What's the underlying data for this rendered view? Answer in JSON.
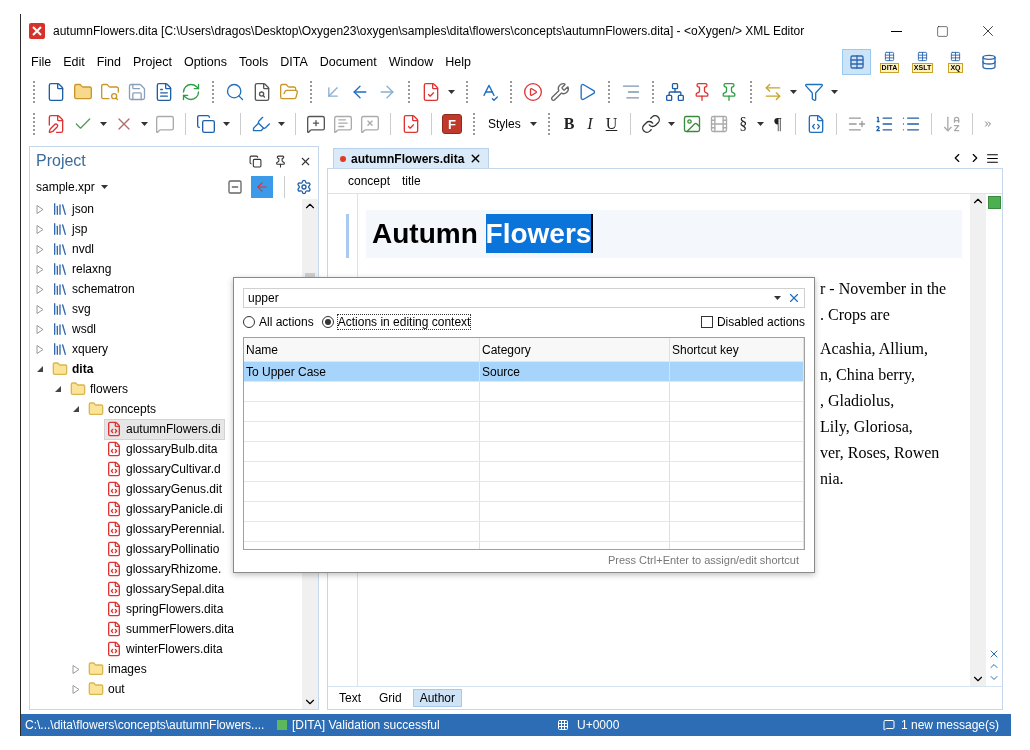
{
  "window": {
    "title": "autumnFlowers.dita [C:\\Users\\dragos\\Desktop\\Oxygen23\\oxygen\\samples\\dita\\flowers\\concepts\\autumnFlowers.dita] - <oXygen/> XML Editor"
  },
  "menu": [
    "File",
    "Edit",
    "Find",
    "Project",
    "Options",
    "Tools",
    "DITA",
    "Document",
    "Window",
    "Help"
  ],
  "perspectives": [
    {
      "kind": "editor",
      "selected": true
    },
    {
      "kind": "tagged",
      "label": "DITA",
      "selected": false
    },
    {
      "kind": "tagged",
      "label": "XSLT",
      "selected": false
    },
    {
      "kind": "tagged",
      "label": "XQ",
      "selected": false
    },
    {
      "kind": "database",
      "selected": false
    }
  ],
  "format_toolbar": {
    "framemaker": "F",
    "styles": "Styles",
    "bold": "B",
    "italic": "I",
    "underline": "U",
    "section": "§",
    "pilcrow": "¶"
  },
  "project": {
    "title": "Project",
    "file": "sample.xpr",
    "link_active": true,
    "tree": [
      {
        "label": "json",
        "kind": "module",
        "expanded": false,
        "bold": false,
        "selected": false
      },
      {
        "label": "jsp",
        "kind": "module",
        "expanded": false,
        "bold": false,
        "selected": false
      },
      {
        "label": "nvdl",
        "kind": "module",
        "expanded": false,
        "bold": false,
        "selected": false
      },
      {
        "label": "relaxng",
        "kind": "module",
        "expanded": false,
        "bold": false,
        "selected": false
      },
      {
        "label": "schematron",
        "kind": "module",
        "expanded": false,
        "bold": false,
        "selected": false
      },
      {
        "label": "svg",
        "kind": "module",
        "expanded": false,
        "bold": false,
        "selected": false
      },
      {
        "label": "wsdl",
        "kind": "module",
        "expanded": false,
        "bold": false,
        "selected": false
      },
      {
        "label": "xquery",
        "kind": "module",
        "expanded": false,
        "bold": false,
        "selected": false
      },
      {
        "label": "dita",
        "kind": "folder",
        "expanded": true,
        "bold": true,
        "selected": false,
        "children": [
          {
            "label": "flowers",
            "kind": "folder",
            "expanded": true,
            "bold": false,
            "selected": false,
            "children": [
              {
                "label": "concepts",
                "kind": "folder",
                "expanded": true,
                "bold": false,
                "selected": false,
                "children": [
                  {
                    "label": "autumnFlowers.di",
                    "kind": "file",
                    "bold": false,
                    "selected": true
                  },
                  {
                    "label": "glossaryBulb.dita",
                    "kind": "file",
                    "bold": false,
                    "selected": false
                  },
                  {
                    "label": "glossaryCultivar.d",
                    "kind": "file",
                    "bold": false,
                    "selected": false
                  },
                  {
                    "label": "glossaryGenus.dit",
                    "kind": "file",
                    "bold": false,
                    "selected": false
                  },
                  {
                    "label": "glossaryPanicle.di",
                    "kind": "file",
                    "bold": false,
                    "selected": false
                  },
                  {
                    "label": "glossaryPerennial.",
                    "kind": "file",
                    "bold": false,
                    "selected": false
                  },
                  {
                    "label": "glossaryPollinatio",
                    "kind": "file",
                    "bold": false,
                    "selected": false
                  },
                  {
                    "label": "glossaryRhizome.",
                    "kind": "file",
                    "bold": false,
                    "selected": false
                  },
                  {
                    "label": "glossarySepal.dita",
                    "kind": "file",
                    "bold": false,
                    "selected": false
                  },
                  {
                    "label": "springFlowers.dita",
                    "kind": "file",
                    "bold": false,
                    "selected": false
                  },
                  {
                    "label": "summerFlowers.dita",
                    "kind": "file",
                    "bold": false,
                    "selected": false
                  },
                  {
                    "label": "winterFlowers.dita",
                    "kind": "file",
                    "bold": false,
                    "selected": false
                  }
                ]
              },
              {
                "label": "images",
                "kind": "folder",
                "expanded": false,
                "bold": false,
                "selected": false
              },
              {
                "label": "out",
                "kind": "folder",
                "expanded": false,
                "bold": false,
                "selected": false
              }
            ]
          }
        ]
      }
    ]
  },
  "editor": {
    "tab": {
      "label": "autumnFlowers.dita",
      "modified": true
    },
    "breadcrumb": [
      "concept",
      "title"
    ],
    "heading": [
      {
        "text": "Autumn",
        "selected": false
      },
      {
        "text": "Flowers",
        "selected": true
      }
    ],
    "paragraphs": [
      [
        "r - November in the",
        ". Crops are"
      ],
      [
        "Acashia, Allium,",
        "n, China berry,",
        ", Gladiolus,",
        "Lily, Gloriosa,",
        "ver, Roses, Rowen",
        "nia."
      ]
    ],
    "modes": [
      {
        "label": "Text",
        "selected": false
      },
      {
        "label": "Grid",
        "selected": false
      },
      {
        "label": "Author",
        "selected": true
      }
    ]
  },
  "dialog": {
    "search": "upper",
    "scopes": [
      {
        "label": "All actions",
        "selected": false
      },
      {
        "label": "Actions in editing context",
        "selected": true
      }
    ],
    "disabled_actions": {
      "label": "Disabled actions",
      "checked": false
    },
    "columns": [
      "Name",
      "Category",
      "Shortcut key"
    ],
    "rows": [
      {
        "name": "To Upper Case",
        "category": "Source",
        "selected": true
      }
    ],
    "hint": "Press Ctrl+Enter to assign/edit shortcut"
  },
  "status_bar": {
    "path": "C:\\...\\dita\\flowers\\concepts\\autumnFlowers....",
    "valid": true,
    "validation": "[DITA] Validation successful",
    "character": "U+0000",
    "messages": "1 new message(s)"
  }
}
